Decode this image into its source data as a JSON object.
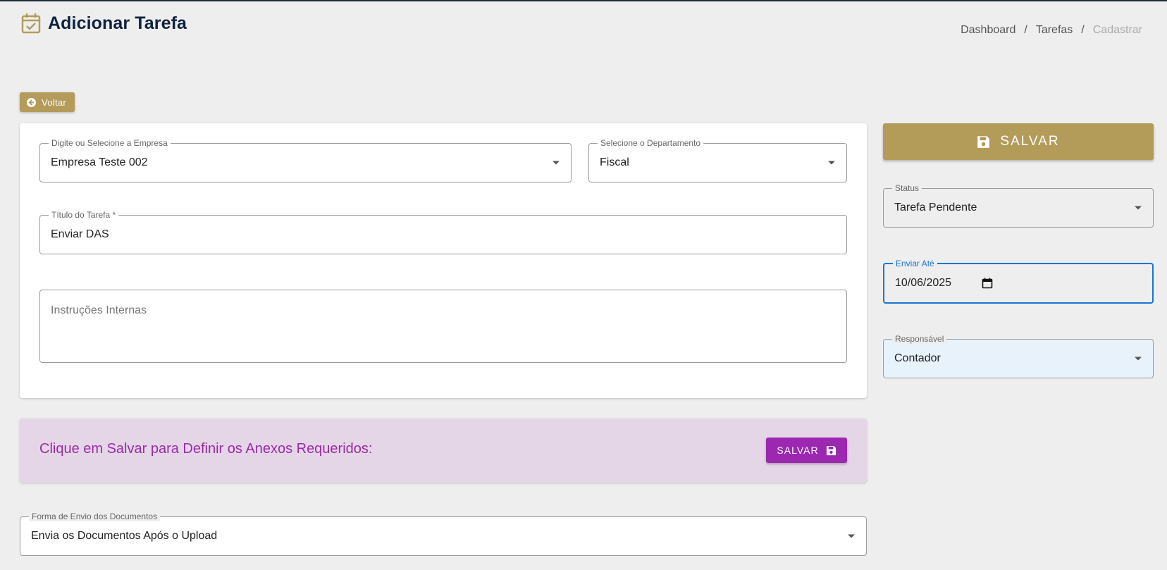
{
  "header": {
    "title": "Adicionar Tarefa",
    "icon": "calendar-check-icon",
    "accent": "#b39b5a"
  },
  "breadcrumb": {
    "items": [
      "Dashboard",
      "Tarefas",
      "Cadastrar"
    ],
    "separator": "/"
  },
  "back_button": {
    "label": "Voltar"
  },
  "form": {
    "empresa": {
      "label": "Digite ou Selecione a Empresa",
      "value": "Empresa Teste 002"
    },
    "departamento": {
      "label": "Selecione o Departamento",
      "value": "Fiscal"
    },
    "titulo": {
      "label": "Título do Tarefa *",
      "value": "Enviar DAS"
    },
    "instrucoes": {
      "placeholder": "Instruções Internas"
    }
  },
  "anexos": {
    "message": "Clique em Salvar para Definir os Anexos Requeridos:",
    "button_label": "SALVAR"
  },
  "forma_envio": {
    "label": "Forma de Envio dos Documentos",
    "value": "Envia os Documentos Após o Upload"
  },
  "sidebar": {
    "save_label": "SALVAR",
    "status": {
      "label": "Status",
      "value": "Tarefa Pendente"
    },
    "enviar_ate": {
      "label": "Enviar Até",
      "value": "10/06/2025"
    },
    "responsavel": {
      "label": "Responsável",
      "value": "Contador"
    }
  },
  "colors": {
    "gold": "#b39b5a",
    "purple": "#9c27b0",
    "focus": "#1976d2"
  }
}
